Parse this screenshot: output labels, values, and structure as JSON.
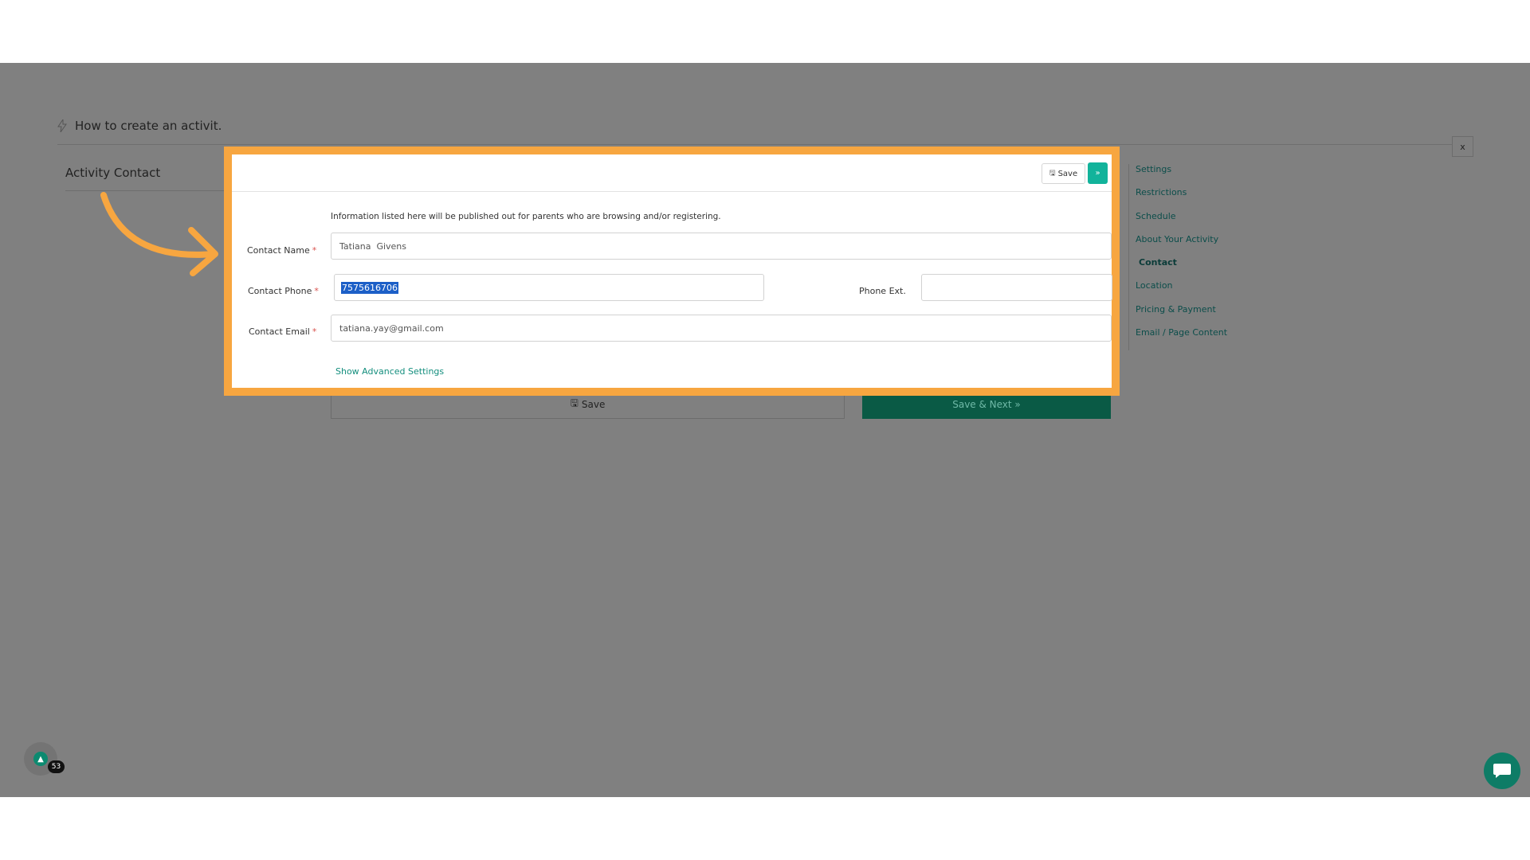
{
  "tutorial": {
    "title": "How to create an activit.",
    "close_label": "x"
  },
  "section": {
    "title": "Activity Contact"
  },
  "side_nav": {
    "items": [
      {
        "label": "Settings",
        "active": false
      },
      {
        "label": "Restrictions",
        "active": false
      },
      {
        "label": "Schedule",
        "active": false
      },
      {
        "label": "About Your Activity",
        "active": false
      },
      {
        "label": "Contact",
        "active": true
      },
      {
        "label": "Location",
        "active": false
      },
      {
        "label": "Pricing & Payment",
        "active": false
      },
      {
        "label": "Email / Page Content",
        "active": false
      }
    ]
  },
  "modal": {
    "save_label": "Save",
    "next_label": "»",
    "info": "Information listed here will be published out for parents who are browsing and/or registering.",
    "fields": {
      "name": {
        "label": "Contact Name",
        "required": "*",
        "value": "Tatiana  Givens"
      },
      "phone": {
        "label": "Contact Phone",
        "required": "*",
        "value": "7575616706"
      },
      "ext": {
        "label": "Phone Ext.",
        "value": ""
      },
      "email": {
        "label": "Contact Email",
        "required": "*",
        "value": "tatiana.yay@gmail.com"
      }
    },
    "advanced_link": "Show Advanced Settings"
  },
  "page_buttons": {
    "save_label": "Save",
    "save_next_label": "Save & Next »"
  },
  "widget": {
    "badge_count": "53"
  },
  "colors": {
    "highlight": "#f7a640",
    "accent": "#12b39b",
    "overlay": "#808080"
  }
}
